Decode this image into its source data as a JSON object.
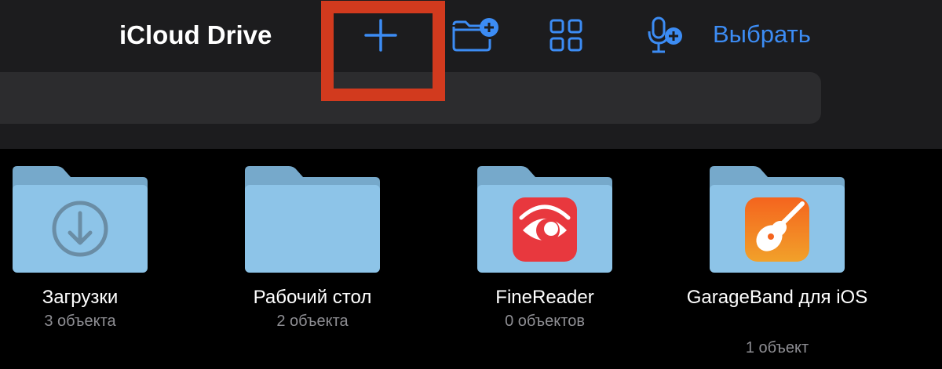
{
  "header": {
    "title": "iCloud Drive",
    "select_label": "Выбрать",
    "icons": [
      "plus-icon",
      "new-folder-icon",
      "grid-view-icon",
      "voice-record-icon"
    ]
  },
  "colors": {
    "accent": "#3c8cf4",
    "highlight": "#d23a1e",
    "folder": "#8dc4e8",
    "folder_tab": "#76a9cb"
  },
  "folders": [
    {
      "name": "Загрузки",
      "count": "3 объекта",
      "icon": "download-icon"
    },
    {
      "name": "Рабочий стол",
      "count": "2 объекта",
      "icon": ""
    },
    {
      "name": "FineReader",
      "count": "0 объектов",
      "icon": "finereader-app-icon"
    },
    {
      "name": "GarageBand для iOS",
      "count": "1 объект",
      "icon": "garageband-app-icon"
    }
  ]
}
